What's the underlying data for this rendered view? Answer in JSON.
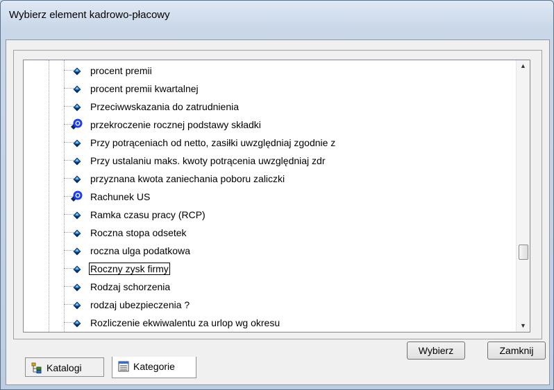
{
  "window": {
    "title": "Wybierz element kadrowo-płacowy"
  },
  "tree": {
    "items": [
      {
        "label": "procent premii",
        "icon": "parameter-diamond-icon"
      },
      {
        "label": "procent premii kwartalnej",
        "icon": "parameter-diamond-icon"
      },
      {
        "label": "Przeciwwskazania do zatrudnienia",
        "icon": "parameter-diamond-icon"
      },
      {
        "label": "przekroczenie rocznej podstawy składki",
        "icon": "blue-circle-icon"
      },
      {
        "label": "Przy potrąceniach od netto, zasiłki uwzględniaj zgodnie z",
        "icon": "parameter-diamond-icon"
      },
      {
        "label": "Przy ustalaniu maks. kwoty potrącenia uwzględniaj zdr",
        "icon": "parameter-diamond-icon"
      },
      {
        "label": "przyznana kwota zaniechania poboru zaliczki",
        "icon": "parameter-diamond-icon"
      },
      {
        "label": "Rachunek US",
        "icon": "blue-circle-icon"
      },
      {
        "label": "Ramka czasu pracy (RCP)",
        "icon": "parameter-diamond-icon"
      },
      {
        "label": "Roczna stopa odsetek",
        "icon": "parameter-diamond-icon"
      },
      {
        "label": "roczna ulga podatkowa",
        "icon": "parameter-diamond-icon"
      },
      {
        "label": "Roczny zysk firmy",
        "icon": "parameter-diamond-icon",
        "selected": true
      },
      {
        "label": "Rodzaj schorzenia",
        "icon": "parameter-diamond-icon"
      },
      {
        "label": "rodzaj ubezpieczenia ?",
        "icon": "parameter-diamond-icon"
      },
      {
        "label": "Rozliczenie ekwiwalentu za urlop wg okresu",
        "icon": "parameter-diamond-icon"
      }
    ]
  },
  "buttons": {
    "select": "Wybierz",
    "close": "Zamknij"
  },
  "tabs": [
    {
      "label": "Katalogi",
      "icon": "tree-catalog-icon",
      "active": false
    },
    {
      "label": "Kategorie",
      "icon": "list-window-icon",
      "active": true
    }
  ],
  "colors": {
    "diamond_blue": "#1e7fd0",
    "diamond_dark": "#0b2a5a",
    "circle_blue": "#1a3cff"
  }
}
